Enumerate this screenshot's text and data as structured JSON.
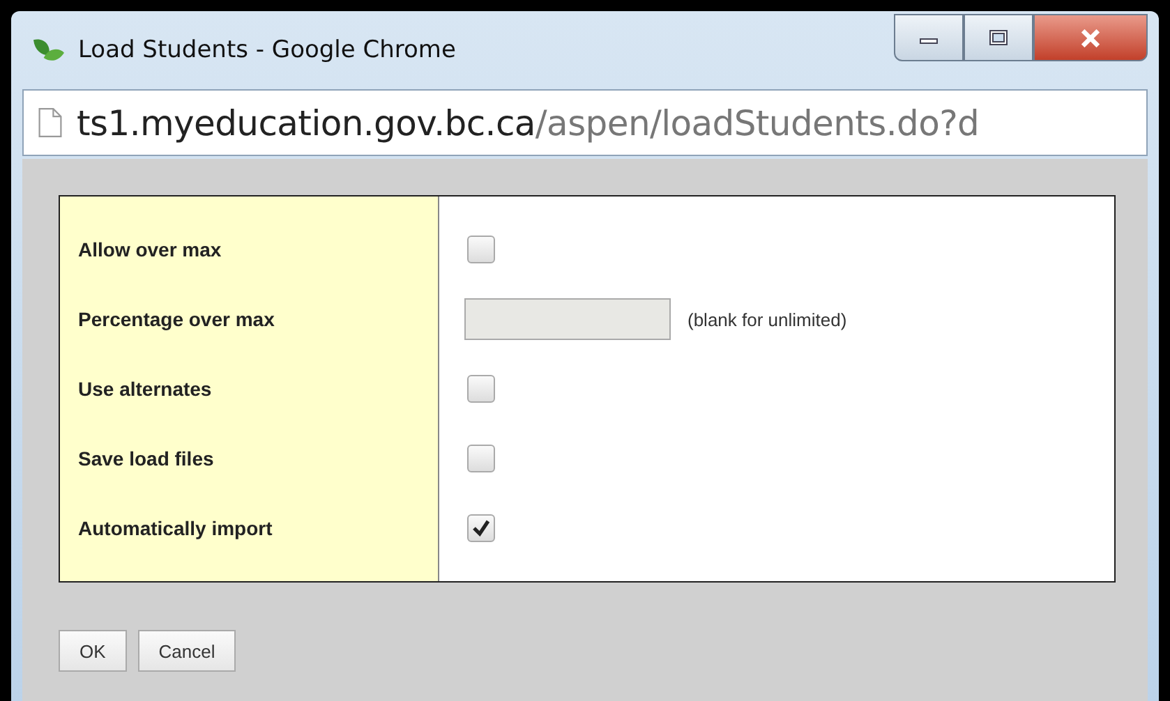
{
  "window": {
    "title": "Load Students - Google Chrome"
  },
  "address_bar": {
    "host": "ts1.myeducation.gov.bc.ca",
    "path": "/aspen/loadStudents.do?d"
  },
  "fields": [
    {
      "kind": "checkbox",
      "label": "Allow over max",
      "checked": false
    },
    {
      "kind": "text",
      "label": "Percentage over max",
      "hint": "(blank for unlimited)"
    },
    {
      "kind": "checkbox",
      "label": "Use alternates",
      "checked": false
    },
    {
      "kind": "checkbox",
      "label": "Save load files",
      "checked": false
    },
    {
      "kind": "checkbox",
      "label": "Automatically import",
      "checked": true
    }
  ],
  "buttons": [
    "OK",
    "Cancel"
  ]
}
